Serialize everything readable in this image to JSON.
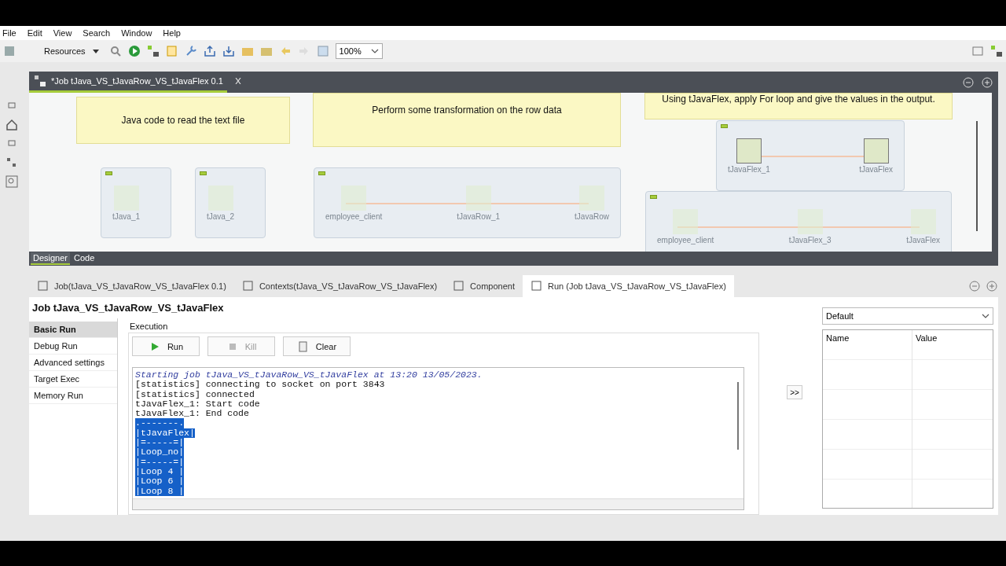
{
  "menu": [
    {
      "label": "File"
    },
    {
      "label": "Edit"
    },
    {
      "label": "View"
    },
    {
      "label": "Search"
    },
    {
      "label": "Window"
    },
    {
      "label": "Help"
    }
  ],
  "toolbar": {
    "perspective": "Resources",
    "zoom": "100%"
  },
  "editor": {
    "tab": {
      "title": "*Job tJava_VS_tJavaRow_VS_tJavaFlex 0.1",
      "selected": true
    },
    "notes": [
      {
        "text": "Java code to read the text file"
      },
      {
        "text": "Perform some transformation on the row data"
      },
      {
        "text": "Using tJavaFlex, apply For loop and give the values in the output."
      }
    ],
    "subjobs": [
      {
        "expanded": true,
        "components": [
          {
            "label": "tJava_1",
            "selected": false
          }
        ]
      },
      {
        "expanded": true,
        "components": [
          {
            "label": "tJava_2",
            "selected": false
          }
        ]
      },
      {
        "expanded": true,
        "components": [
          {
            "label": "employee_client",
            "selected": false
          },
          {
            "label": "tJavaRow_1",
            "selected": false
          },
          {
            "label": "tJavaRow",
            "selected": false
          }
        ]
      },
      {
        "expanded": true,
        "components": [
          {
            "label": "tJavaFlex_1",
            "selected": true
          },
          {
            "label": "tJavaFlex",
            "selected": true
          }
        ]
      },
      {
        "expanded": true,
        "components": [
          {
            "label": "employee_client",
            "selected": false
          },
          {
            "label": "tJavaFlex_3",
            "selected": false
          },
          {
            "label": "tJavaFlex",
            "selected": false
          }
        ]
      }
    ],
    "view_tabs": [
      {
        "label": "Designer",
        "selected": true
      },
      {
        "label": "Code",
        "selected": false
      }
    ]
  },
  "panel": {
    "tabs": [
      {
        "label": "Job(tJava_VS_tJavaRow_VS_tJavaFlex 0.1)",
        "selected": false
      },
      {
        "label": "Contexts(tJava_VS_tJavaRow_VS_tJavaFlex)",
        "selected": false
      },
      {
        "label": "Component",
        "selected": false
      },
      {
        "label": "Run (Job tJava_VS_tJavaRow_VS_tJavaFlex)",
        "selected": true
      }
    ],
    "title": "Job tJava_VS_tJavaRow_VS_tJavaFlex",
    "run_modes": [
      {
        "label": "Basic Run",
        "selected": true
      },
      {
        "label": "Debug Run",
        "selected": false
      },
      {
        "label": "Advanced settings",
        "selected": false
      },
      {
        "label": "Target Exec",
        "selected": false
      },
      {
        "label": "Memory Run",
        "selected": false
      }
    ],
    "execution": {
      "title": "Execution",
      "buttons": [
        {
          "label": "Run",
          "kind": "run",
          "disabled": false
        },
        {
          "label": "Kill",
          "kind": "kill",
          "disabled": true
        },
        {
          "label": "Clear",
          "kind": "clear",
          "disabled": false
        }
      ]
    },
    "console": [
      {
        "text": "Starting job tJava_VS_tJavaRow_VS_tJavaFlex at 13:20 13/05/2023.",
        "kind": "header",
        "selected": false
      },
      {
        "text": "[statistics] connecting to socket on port 3843",
        "kind": "plain",
        "selected": false
      },
      {
        "text": "[statistics] connected",
        "kind": "plain",
        "selected": false
      },
      {
        "text": "tJavaFlex_1: Start code",
        "kind": "plain",
        "selected": false
      },
      {
        "text": "tJavaFlex_1: End code",
        "kind": "plain",
        "selected": false
      },
      {
        "text": ".-------.",
        "kind": "plain",
        "selected": true
      },
      {
        "text": "|tJavaFlex|",
        "kind": "plain",
        "selected": true
      },
      {
        "text": "|=-----=|",
        "kind": "plain",
        "selected": true
      },
      {
        "text": "|Loop_no|",
        "kind": "plain",
        "selected": true
      },
      {
        "text": "|=-----=|",
        "kind": "plain",
        "selected": true
      },
      {
        "text": "|Loop 4 |",
        "kind": "plain",
        "selected": true
      },
      {
        "text": "|Loop 6 |",
        "kind": "plain",
        "selected": true
      },
      {
        "text": "|Loop 8 |",
        "kind": "plain",
        "selected": true
      }
    ],
    "transfer": ">>",
    "context": {
      "value": "Default",
      "columns": [
        "Name",
        "Value"
      ]
    }
  }
}
